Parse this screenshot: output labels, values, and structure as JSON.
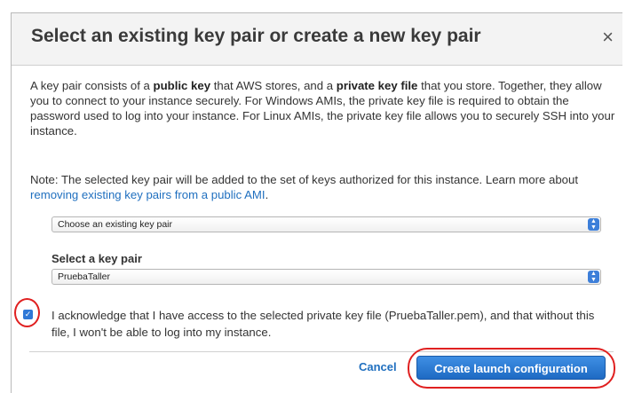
{
  "dialog": {
    "title": "Select an existing key pair or create a new key pair",
    "close_glyph": "×",
    "intro": {
      "t1": "A key pair consists of a ",
      "b1": "public key",
      "t2": " that AWS stores, and a ",
      "b2": "private key file",
      "t3": " that you store. Together, they allow you to connect to your instance securely. For Windows AMIs, the private key file is required to obtain the password used to log into your instance. For Linux AMIs, the private key file allows you to securely SSH into your instance."
    },
    "note": {
      "text": "Note: The selected key pair will be added to the set of keys authorized for this instance. Learn more about ",
      "link": "removing existing key pairs from a public AMI",
      "end": "."
    },
    "mode_select": {
      "value": "Choose an existing key pair"
    },
    "key_pair": {
      "label": "Select a key pair",
      "value": "PruebaTaller"
    },
    "acknowledge": {
      "checked": true,
      "text": "I acknowledge that I have access to the selected private key file (PruebaTaller.pem), and that without this file, I won't be able to log into my instance."
    },
    "cancel_label": "Cancel",
    "submit_label": "Create launch configuration",
    "colors": {
      "accent": "#2f78d6",
      "highlight": "#e02020",
      "link": "#1f6fbf"
    },
    "icons": {
      "close": "close-icon",
      "select": "select-arrows-icon",
      "check": "checkmark-icon"
    }
  }
}
